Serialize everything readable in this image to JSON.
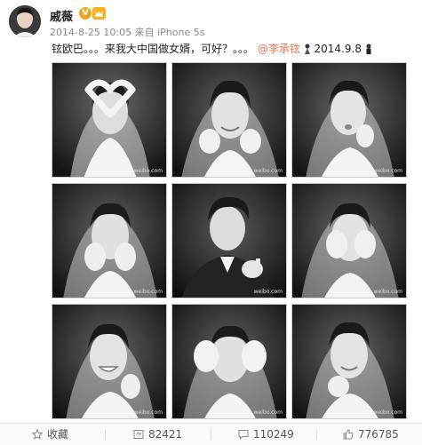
{
  "post": {
    "username": "戚薇",
    "verified_mark": "V",
    "timestamp": "2014-8-25 10:05",
    "source": "来自 iPhone 5s",
    "text_main": "铉欧巴。。。来我大中国做女婿，可好？。。。",
    "mention": "@李承铉",
    "text_date": "2014.9.8"
  },
  "photos": {
    "count": 9,
    "watermark": "weibo.com"
  },
  "actions": {
    "favorite_label": "收藏",
    "repost_count": "82421",
    "comment_count": "110249",
    "like_count": "776785"
  },
  "icons": {
    "verified": "verified-badge-icon",
    "member": "vip-member-icon",
    "favorite": "star-icon",
    "repost": "repost-icon",
    "comment": "comment-icon",
    "like": "thumbs-up-icon"
  },
  "colors": {
    "mention": "#eb7350",
    "verified": "#f0a51c",
    "text": "#222222",
    "meta": "#888888"
  }
}
